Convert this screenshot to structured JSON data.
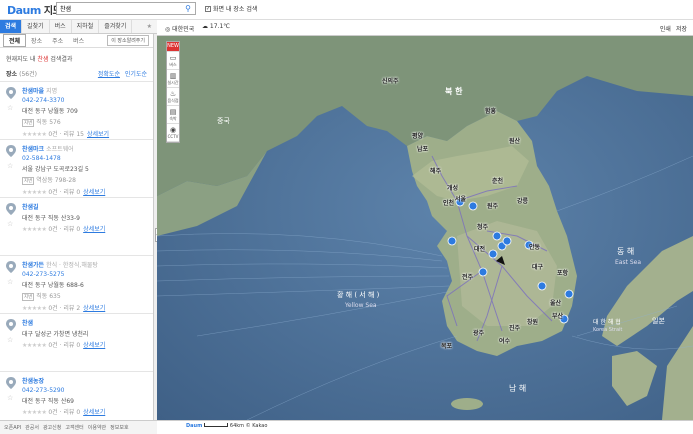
{
  "header": {
    "logo": "Daum",
    "logo_sub": "지도",
    "search_value": "찬샘",
    "search_icon": "search-icon",
    "map_only_label": "화면 내 장소 검색"
  },
  "tabs": [
    {
      "label": "검색",
      "active": true
    },
    {
      "label": "길찾기"
    },
    {
      "label": "버스"
    },
    {
      "label": "지하철"
    },
    {
      "label": "즐겨찾기"
    }
  ],
  "subtabs": {
    "items": [
      "전체",
      "장소",
      "주소",
      "버스"
    ],
    "help_button": "이 장소알려주기"
  },
  "result_header": {
    "prefix": "현재지도 내 ",
    "keyword": "찬샘",
    "suffix": " 검색결과"
  },
  "sort": {
    "label": "장소",
    "count": "(56건)",
    "options": [
      "정확도순",
      "인기도순"
    ]
  },
  "results": [
    {
      "name": "찬샘마을",
      "category": "지명",
      "phone": "042-274-3370",
      "address": "대전 동구 낭월동 709",
      "lot_tag": "지번",
      "lot": "직동 576",
      "reviews": "0건 · 리뷰 15",
      "detail": "상세보기"
    },
    {
      "name": "찬샘마크",
      "category": "소프트웨어",
      "phone": "02-584-1478",
      "address": "서울 강남구 도곡로23길 5",
      "lot_tag": "지번",
      "lot": "역삼동 798-28",
      "reviews": "0건 · 리뷰 0",
      "detail": "상세보기"
    },
    {
      "name": "찬샘길",
      "category": "",
      "phone": "",
      "address": "대전 동구 직동 산33-9",
      "lot_tag": "지번",
      "lot": "",
      "reviews": "0건 · 리뷰 0",
      "detail": "상세보기"
    },
    {
      "name": "찬샘가든",
      "category": "한식 · 한정식,해물탕",
      "phone": "042-273-5275",
      "address": "대전 동구 낭월동 688-6",
      "lot_tag": "지번",
      "lot": "직동 635",
      "reviews": "0건 · 리뷰 2",
      "detail": "상세보기"
    },
    {
      "name": "찬샘",
      "category": "",
      "phone": "",
      "address": "대구 달성군 가창면 냉천리",
      "lot_tag": "지번",
      "lot": "",
      "reviews": "0건 · 리뷰 0",
      "detail": "상세보기"
    },
    {
      "name": "찬샘농장",
      "category": "",
      "phone": "042-273-5290",
      "address": "대전 동구 직동 산69",
      "lot_tag": "지번",
      "lot": "",
      "reviews": "0건 · 리뷰 0",
      "detail": "상세보기"
    }
  ],
  "mapbar": {
    "region": "대한민국",
    "weather": "17.1℃",
    "print": "인쇄",
    "save": "저장"
  },
  "maptools": {
    "new_badge": "NEW",
    "items": [
      {
        "icon": "bus-icon",
        "label": "버스"
      },
      {
        "icon": "traffic-icon",
        "label": "실시간"
      },
      {
        "icon": "food-icon",
        "label": "음식점"
      },
      {
        "icon": "hotel-icon",
        "label": "숙박"
      },
      {
        "icon": "cctv-icon",
        "label": "CCTV"
      }
    ]
  },
  "map_labels": {
    "china": "중국",
    "north_korea": "북 한",
    "yellow_sea": "황 해 ( 서 해 )",
    "yellow_sea_en": "Yellow Sea",
    "east_sea": "동 해",
    "east_sea_en": "East Sea",
    "korea_strait": "대 한 해 협",
    "korea_strait_en": "Korea Strait",
    "south_sea": "남 해",
    "japan": "일본",
    "donghae": "동해",
    "cities": [
      "신의주",
      "평양",
      "남포",
      "해주",
      "개성",
      "서울",
      "인천",
      "원주",
      "대전",
      "대구",
      "울산",
      "부산",
      "광주",
      "목포",
      "여수",
      "진주",
      "창원",
      "포항",
      "안동",
      "강릉",
      "춘천",
      "청주",
      "전주",
      "함흥",
      "원산"
    ]
  },
  "scale": {
    "label": "64km",
    "copyright": "© Kakao"
  },
  "footer": [
    "오픈API",
    "관공서",
    "광고신청",
    "고객센터",
    "이용약관",
    "정보보호"
  ]
}
